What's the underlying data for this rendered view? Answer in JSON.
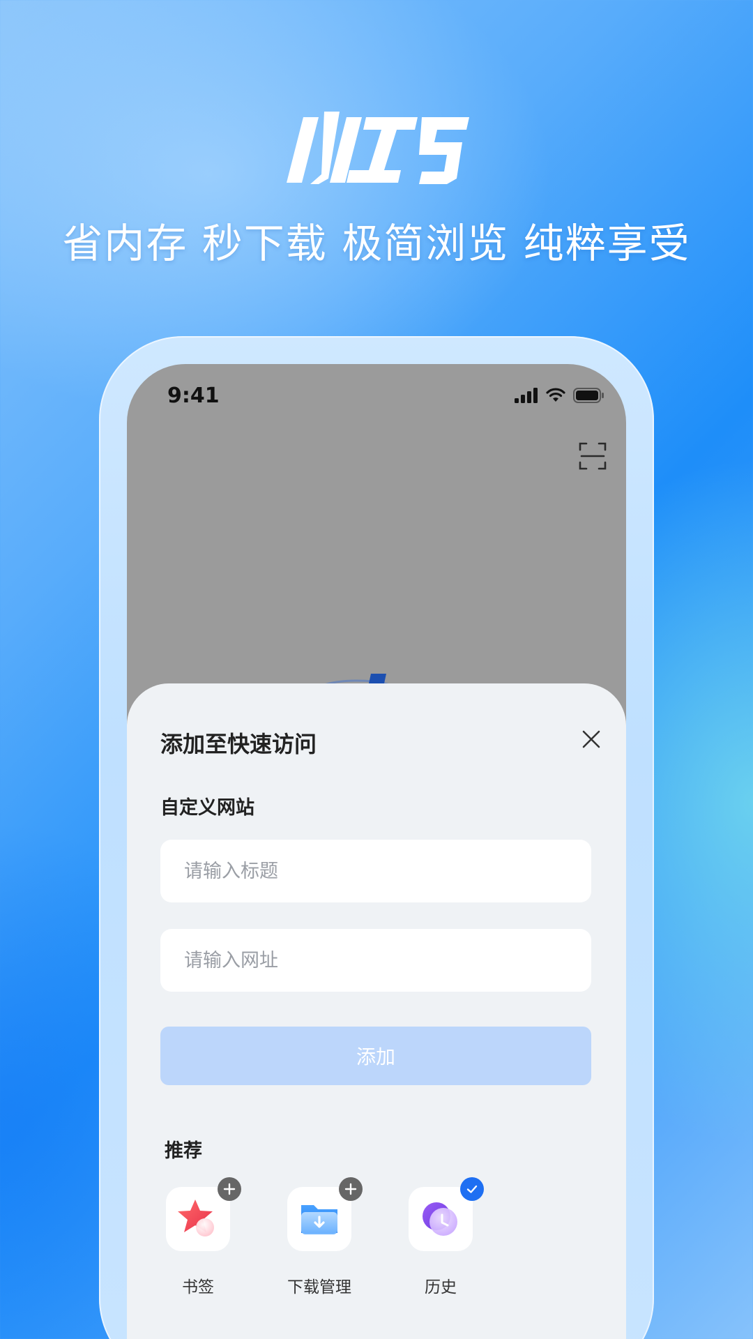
{
  "header": {
    "logo_text": "小巧",
    "tagline": "省内存 秒下载 极简浏览 纯粹享受"
  },
  "status_bar": {
    "time": "9:41"
  },
  "sheet": {
    "title": "添加至快速访问",
    "custom_section_label": "自定义网站",
    "title_placeholder": "请输入标题",
    "title_value": "",
    "url_placeholder": "请输入网址",
    "url_value": "",
    "add_button_label": "添加",
    "recommend_label": "推荐",
    "recommendations": [
      {
        "label": "书签",
        "icon": "bookmark-star-icon",
        "state": "add"
      },
      {
        "label": "下载管理",
        "icon": "download-folder-icon",
        "state": "add"
      },
      {
        "label": "历史",
        "icon": "history-clock-icon",
        "state": "added"
      }
    ]
  },
  "colors": {
    "accent_blue": "#1e6ff2",
    "add_button_disabled": "#bcd6fb",
    "sheet_bg": "#eff2f5",
    "badge_gray": "#666666"
  }
}
